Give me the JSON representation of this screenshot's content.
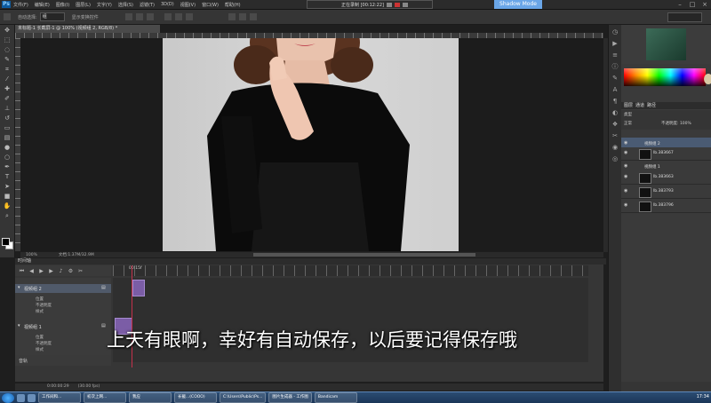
{
  "menubar": {
    "logo": "Ps",
    "items": [
      "文件(F)",
      "编辑(E)",
      "图像(I)",
      "图层(L)",
      "文字(Y)",
      "选择(S)",
      "滤镜(T)",
      "3D(D)",
      "视图(V)",
      "窗口(W)",
      "帮助(H)"
    ]
  },
  "recorder": {
    "text": "正在录制 [00:12:22]"
  },
  "badge": {
    "label": "Shadow Mode"
  },
  "options": {
    "a": "自动选择:",
    "b": "组",
    "c": "显示变换控件"
  },
  "document": {
    "tab": "未标题-1 长截屏-1 @ 100% (视频组 2, RGB/8) *",
    "status_zoom": "100%",
    "status_doc": "文档:1.37M/32.9M"
  },
  "layers_panel": {
    "tabs": [
      "图层",
      "通道",
      "路径"
    ],
    "kind_label": "类型",
    "blend_mode": "正常",
    "opacity_label": "不透明度: 100%",
    "rows": [
      {
        "name": "视频组 2",
        "group": true,
        "selected": true
      },
      {
        "name": "lb.383667",
        "group": false,
        "selected": false
      },
      {
        "name": "视频组 1",
        "group": true,
        "selected": false
      },
      {
        "name": "lb.383663",
        "group": false,
        "selected": false
      },
      {
        "name": "lb.383793",
        "group": false,
        "selected": false
      },
      {
        "name": "lb.383796",
        "group": false,
        "selected": false
      }
    ]
  },
  "timeline": {
    "tab": "时间轴",
    "time_marker": "00:15f",
    "tracks": [
      {
        "name": "视频组 2",
        "props": [
          "位置",
          "不透明度",
          "样式"
        ]
      },
      {
        "name": "视频组 1",
        "props": [
          "位置",
          "不透明度",
          "样式"
        ]
      }
    ],
    "audio": "音轨",
    "bottom": {
      "time": "0:00:00:29",
      "fps": "(30.00 fps)"
    }
  },
  "subtitle": "上天有眼啊，幸好有自动保存，以后要记得保存哦",
  "taskbar": {
    "tasks": [
      "工作间和...",
      "初次上网...",
      "我应",
      "长截...(COOO)",
      "C:\\Users\\Public\\Ps...",
      "图片生成器 - 工作图",
      "Bandicam"
    ],
    "clock": "17:34"
  }
}
